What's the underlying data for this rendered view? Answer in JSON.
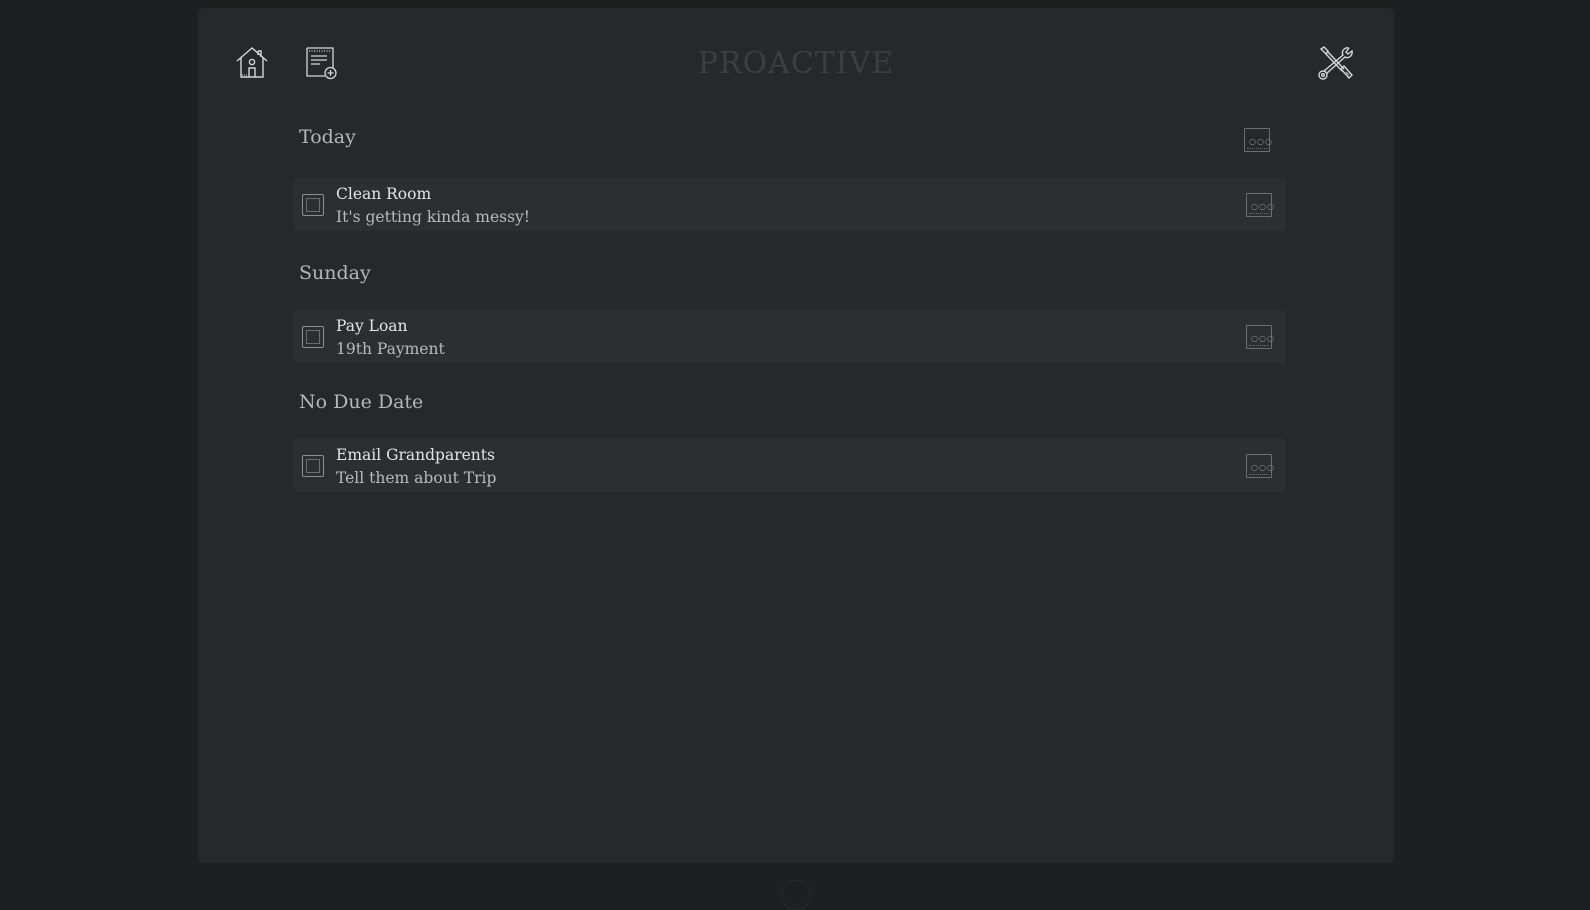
{
  "app": {
    "title": "PROACTIVE"
  },
  "toolbar": {
    "icons": [
      "home-icon",
      "new-task-icon",
      "settings-icon"
    ]
  },
  "sections": [
    {
      "title": "Today",
      "tasks": [
        {
          "title": "Clean Room",
          "description": "It's getting kinda messy!"
        }
      ]
    },
    {
      "title": "Sunday",
      "tasks": [
        {
          "title": "Pay Loan",
          "description": "19th Payment"
        }
      ]
    },
    {
      "title": "No Due Date",
      "tasks": [
        {
          "title": "Email Grandparents",
          "description": "Tell them about Trip"
        }
      ]
    }
  ],
  "more_button": {
    "dots": "○○○"
  },
  "colors": {
    "background": "#1e1f21",
    "panel": "#27282c",
    "row": "#2d2e32",
    "text": "#e3e4e6",
    "muted": "#b4b6ba"
  }
}
